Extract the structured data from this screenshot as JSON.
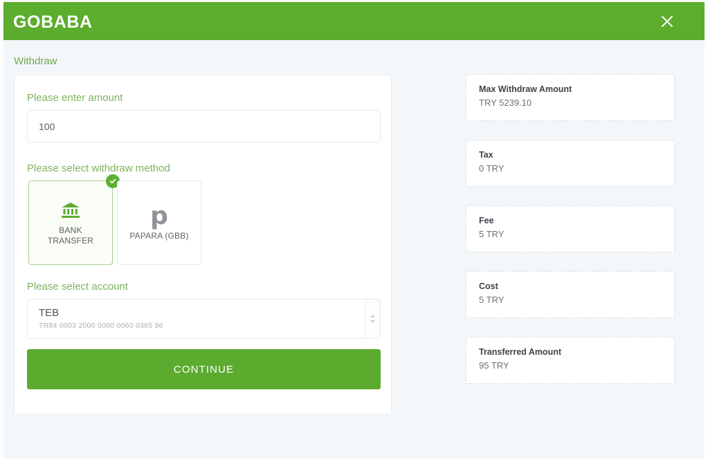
{
  "header": {
    "brand": "GOBABA",
    "close_label": "close-icon",
    "bg_color": "#5cac2e"
  },
  "breadcrumb": {
    "label": "Withdraw"
  },
  "form": {
    "amount": {
      "label": "Please enter amount",
      "value": "100",
      "placeholder": "Please enter amount"
    },
    "method": {
      "label": "Please select withdraw method",
      "options": [
        {
          "name": "BANK\nTRANSFER",
          "name_line1": "BANK",
          "name_line2": "TRANSFER",
          "icon": "bank-icon",
          "selected": true
        },
        {
          "name": "PAPARA (GBB)",
          "name_line1": "PAPARA (GBB)",
          "name_line2": "",
          "icon": "papara-icon",
          "selected": false
        }
      ]
    },
    "account": {
      "label": "Please select account",
      "bank": "TEB",
      "iban": "TR84 0003 2000 0000 0060 0385 96"
    },
    "submit_label": "CONTINUE"
  },
  "summary": {
    "cards": [
      {
        "title": "Max Withdraw Amount",
        "value": "TRY 5239.10"
      },
      {
        "title": "Tax",
        "value": "0 TRY"
      },
      {
        "title": "Fee",
        "value": "5 TRY"
      },
      {
        "title": "Cost",
        "value": "5 TRY"
      },
      {
        "title": "Transferred Amount",
        "value": "95 TRY"
      }
    ]
  },
  "colors": {
    "brand_green": "#5cac2e",
    "label_green": "#7cb35c",
    "page_bg": "#f4f7f9"
  }
}
